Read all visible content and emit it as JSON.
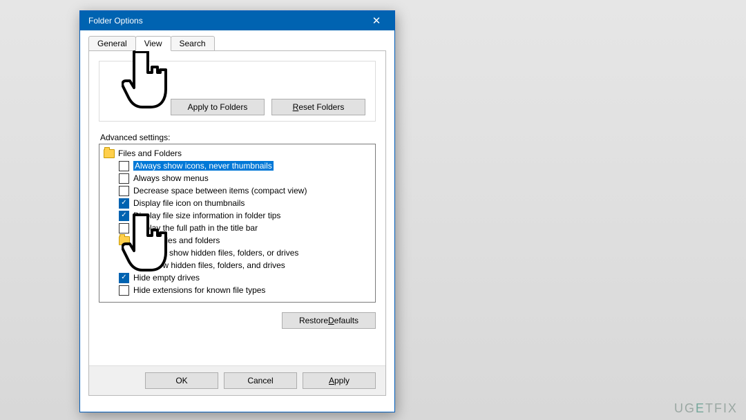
{
  "window": {
    "title": "Folder Options",
    "close_symbol": "✕",
    "tabs": {
      "general": "General",
      "view": "View",
      "search": "Search"
    }
  },
  "folder_views": {
    "apply": "Apply to Folders",
    "reset_prefix": "R",
    "reset_rest": "eset Folders"
  },
  "advanced_label": "Advanced settings:",
  "restore_prefix": "Restore ",
  "restore_u": "D",
  "restore_rest": "efaults",
  "footer": {
    "ok": "OK",
    "cancel": "Cancel",
    "apply_u": "A",
    "apply_rest": "pply"
  },
  "tree": {
    "root": "Files and Folders",
    "i0": "Always show icons, never thumbnails",
    "i1": "Always show menus",
    "i2": "Decrease space between items (compact view)",
    "i3": "Display file icon on thumbnails",
    "i4": "Display file size information in folder tips",
    "i5": "Display the full path in the title bar",
    "sub": "Hidden files and folders",
    "r0": "Don't show hidden files, folders, or drives",
    "r1": "Show hidden files, folders, and drives",
    "i6": "Hide empty drives",
    "i7": "Hide extensions for known file types"
  },
  "watermark": {
    "a": "UG",
    "b": "E",
    "c": "TFIX"
  }
}
